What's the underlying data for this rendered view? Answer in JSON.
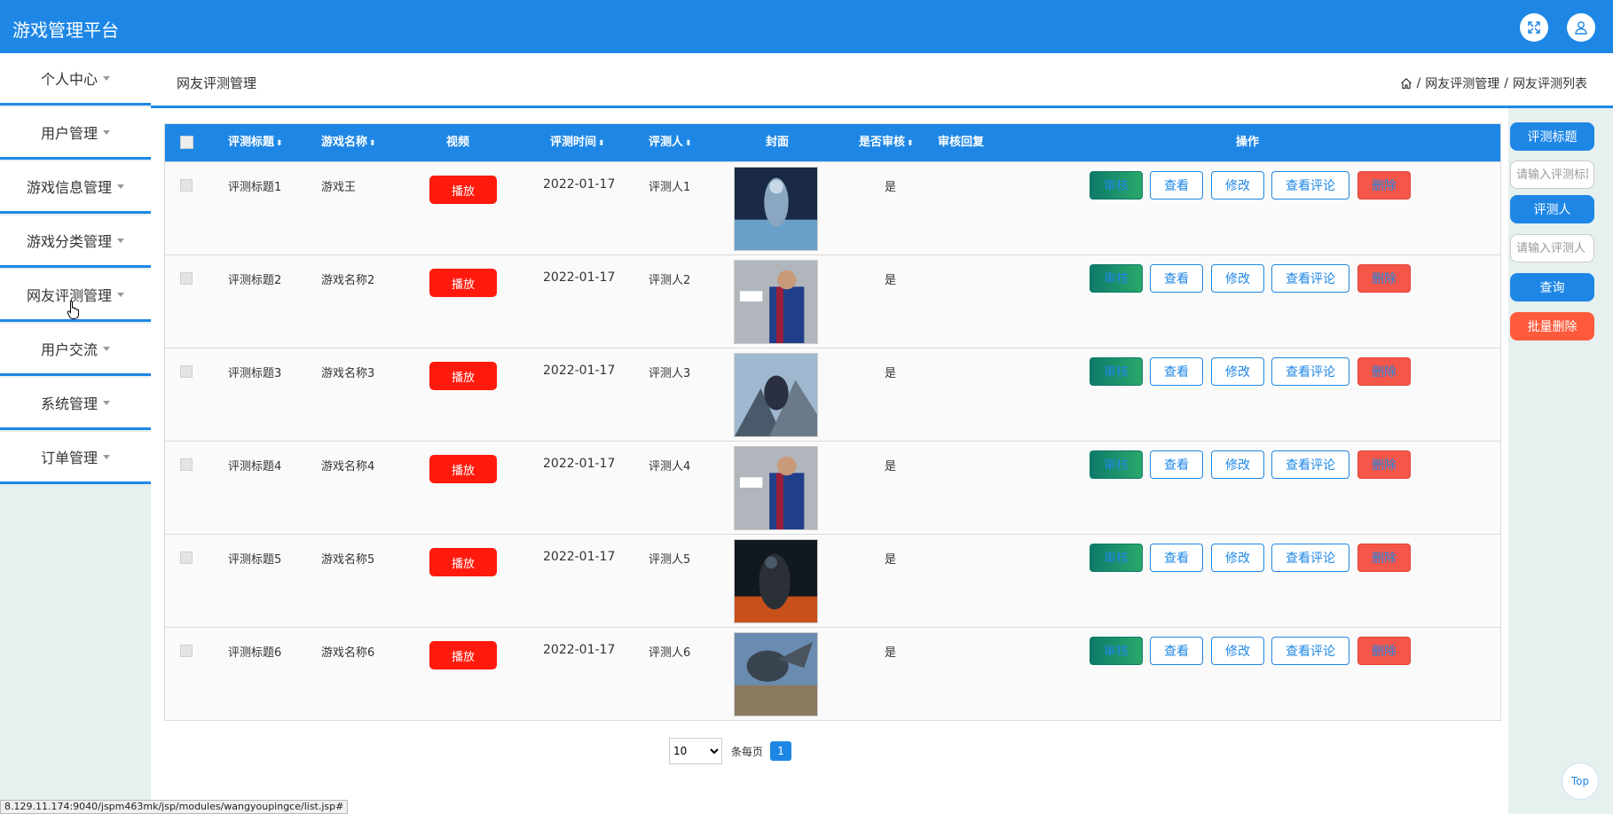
{
  "app": {
    "title": "游戏管理平台"
  },
  "header_icons": {
    "fullscreen": "fullscreen-icon",
    "user": "user-icon"
  },
  "sidebar": {
    "items": [
      {
        "label": "个人中心"
      },
      {
        "label": "用户管理"
      },
      {
        "label": "游戏信息管理"
      },
      {
        "label": "游戏分类管理"
      },
      {
        "label": "网友评测管理"
      },
      {
        "label": "用户交流"
      },
      {
        "label": "系统管理"
      },
      {
        "label": "订单管理"
      }
    ]
  },
  "page": {
    "title": "网友评测管理"
  },
  "breadcrumb": {
    "level1": "网友评测管理",
    "level2": "网友评测列表"
  },
  "table": {
    "headers": {
      "title": "评测标题",
      "game": "游戏名称",
      "video": "视频",
      "time": "评测时间",
      "reviewer": "评测人",
      "cover": "封面",
      "audited": "是否审核",
      "reply": "审核回复",
      "ops": "操作"
    },
    "play_label": "播放",
    "op_labels": {
      "audit": "审核",
      "view": "查看",
      "edit": "修改",
      "comments": "查看评论",
      "delete": "删除"
    },
    "rows": [
      {
        "title": "评测标题1",
        "game": "游戏王",
        "time": "2022-01-17",
        "reviewer": "评测人1",
        "audited": "是",
        "reply": ""
      },
      {
        "title": "评测标题2",
        "game": "游戏名称2",
        "time": "2022-01-17",
        "reviewer": "评测人2",
        "audited": "是",
        "reply": ""
      },
      {
        "title": "评测标题3",
        "game": "游戏名称3",
        "time": "2022-01-17",
        "reviewer": "评测人3",
        "audited": "是",
        "reply": ""
      },
      {
        "title": "评测标题4",
        "game": "游戏名称4",
        "time": "2022-01-17",
        "reviewer": "评测人4",
        "audited": "是",
        "reply": ""
      },
      {
        "title": "评测标题5",
        "game": "游戏名称5",
        "time": "2022-01-17",
        "reviewer": "评测人5",
        "audited": "是",
        "reply": ""
      },
      {
        "title": "评测标题6",
        "game": "游戏名称6",
        "time": "2022-01-17",
        "reviewer": "评测人6",
        "audited": "是",
        "reply": ""
      }
    ]
  },
  "search": {
    "title_label": "评测标题",
    "title_placeholder": "请输入评测标题",
    "reviewer_label": "评测人",
    "reviewer_placeholder": "请输入评测人",
    "query_label": "查询",
    "batch_delete_label": "批量删除"
  },
  "pagination": {
    "page_size": "10",
    "per_page_label": "条每页",
    "current_page": "1"
  },
  "top_button": {
    "label": "Top"
  },
  "status_url": "8.129.11.174:9040/jspm463mk/jsp/modules/wangyoupingce/list.jsp#",
  "colors": {
    "primary": "#1e87e6",
    "danger": "#f5564a",
    "play": "#ff1a0d",
    "audit": "#0e7a6a"
  }
}
